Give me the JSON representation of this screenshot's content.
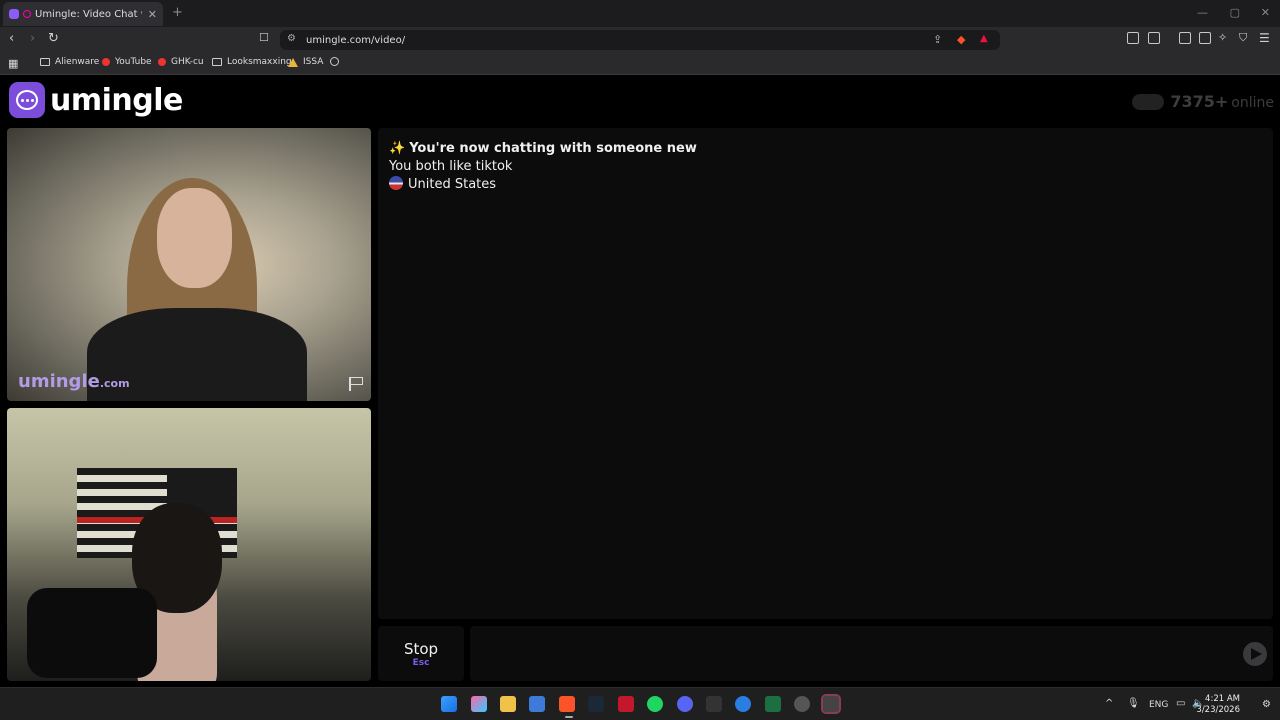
{
  "browser": {
    "tab_title": "Umingle: Video Chat with Str",
    "url": "umingle.com/video/",
    "bookmarks": [
      "Alienware",
      "YouTube",
      "GHK-cu",
      "Looksmaxxing",
      "ISSA"
    ]
  },
  "page": {
    "logo_text": "umingle",
    "online_count": "7375+",
    "online_label": "online",
    "watermark_main": "umingle",
    "watermark_suffix": ".com",
    "chat": {
      "intro": "You're now chatting with someone new",
      "interest": "You both like tiktok",
      "country": "United States"
    },
    "stop_label": "Stop",
    "stop_key": "Esc",
    "message_placeholder": ""
  },
  "taskbar": {
    "lang": "ENG",
    "time": "4:21 AM",
    "date": "3/23/2026"
  }
}
